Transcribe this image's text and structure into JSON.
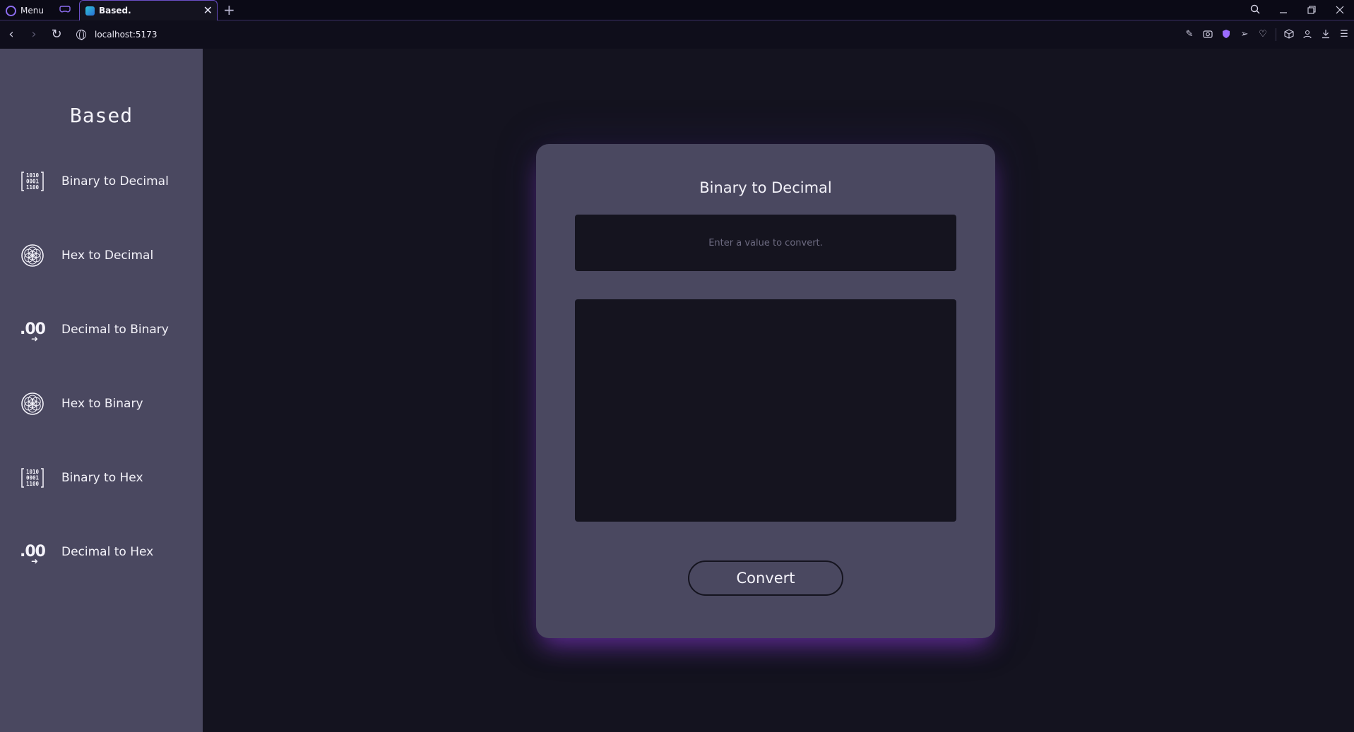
{
  "browser": {
    "menu_label": "Menu",
    "tab": {
      "title": "Based.",
      "close_glyph": "✕"
    },
    "new_tab_glyph": "+",
    "url": "localhost:5173",
    "window_controls": [
      "search-icon",
      "minimize-icon",
      "restore-icon",
      "close-icon"
    ],
    "toolbar_icons": [
      "edit-icon",
      "camera-icon",
      "shield-icon",
      "send-icon",
      "heart-icon",
      "cube-icon",
      "user-icon",
      "download-icon",
      "menu-icon"
    ],
    "accent_color": "#8c6cf0"
  },
  "sidebar": {
    "brand": "Based",
    "items": [
      {
        "label": "Binary to Decimal",
        "icon": "binary-icon"
      },
      {
        "label": "Hex to Decimal",
        "icon": "hex-icon"
      },
      {
        "label": "Decimal to Binary",
        "icon": "decimal-icon"
      },
      {
        "label": "Hex to Binary",
        "icon": "hex-icon"
      },
      {
        "label": "Binary to Hex",
        "icon": "binary-icon"
      },
      {
        "label": "Decimal to Hex",
        "icon": "decimal-icon"
      }
    ]
  },
  "converter": {
    "title": "Binary to Decimal",
    "input_placeholder": "Enter a value to convert.",
    "input_value": "",
    "output_value": "",
    "button_label": "Convert"
  },
  "icon_glyphs": {
    "binary_rows": [
      "1010",
      "0001",
      "1100"
    ],
    "decimal_text": ".00",
    "decimal_arrow": "➜"
  }
}
